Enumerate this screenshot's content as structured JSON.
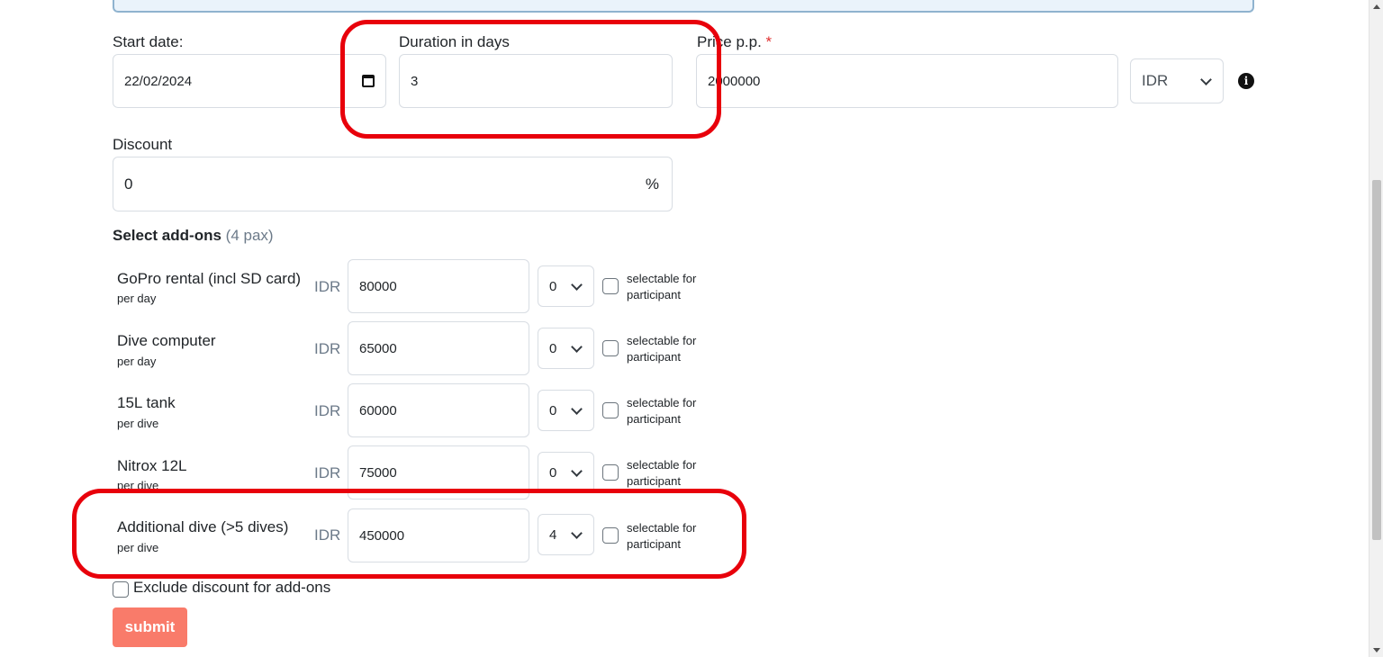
{
  "form": {
    "start_date": {
      "label": "Start date:",
      "value": "22/02/2024"
    },
    "duration": {
      "label": "Duration in days",
      "value": "3"
    },
    "price": {
      "label": "Price p.p.",
      "required_mark": "*",
      "value": "2000000"
    },
    "currency": {
      "selected": "IDR"
    },
    "discount": {
      "label": "Discount",
      "value": "0",
      "unit": "%"
    },
    "addons_title": "Select add-ons",
    "addons_pax": "(4 pax)",
    "addons": [
      {
        "name": "GoPro rental (incl SD card)",
        "unit": "per day",
        "currency": "IDR",
        "price": "80000",
        "qty": "0",
        "selectable_label": "selectable for participant",
        "selectable": false
      },
      {
        "name": "Dive computer",
        "unit": "per day",
        "currency": "IDR",
        "price": "65000",
        "qty": "0",
        "selectable_label": "selectable for participant",
        "selectable": false
      },
      {
        "name": "15L tank",
        "unit": "per dive",
        "currency": "IDR",
        "price": "60000",
        "qty": "0",
        "selectable_label": "selectable for participant",
        "selectable": false
      },
      {
        "name": "Nitrox 12L",
        "unit": "per dive",
        "currency": "IDR",
        "price": "75000",
        "qty": "0",
        "selectable_label": "selectable for participant",
        "selectable": false
      },
      {
        "name": "Additional dive (>5 dives)",
        "unit": "per dive",
        "currency": "IDR",
        "price": "450000",
        "qty": "4",
        "selectable_label": "selectable for participant",
        "selectable": false
      }
    ],
    "exclude_discount_label": "Exclude discount for add-ons",
    "exclude_discount": false,
    "submit_label": "submit"
  },
  "colors": {
    "accent_button": "#f97b6a",
    "annotation": "#e8000b",
    "muted_text": "#6c7a89"
  }
}
